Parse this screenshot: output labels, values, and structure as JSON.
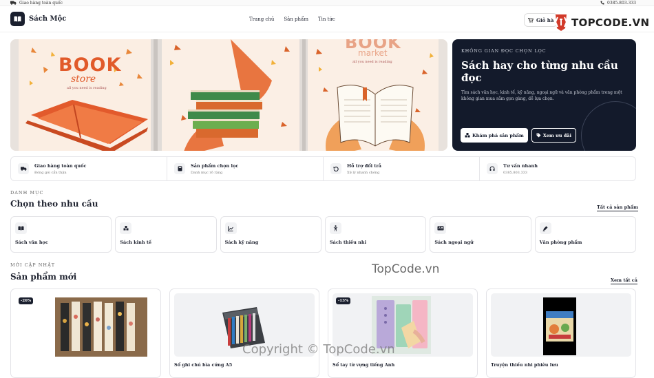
{
  "topbar": {
    "left": "Giao hàng toàn quốc",
    "right": "0385.803.333"
  },
  "nav": {
    "brand": "Sách Mộc",
    "items": [
      "Trang chủ",
      "Sản phẩm",
      "Tin tức"
    ],
    "cart_label": "Giỏ hà"
  },
  "watermark": {
    "brand": "TOPCODE.VN",
    "center": "TopCode.vn",
    "copyright": "Copyright © TopCode.vn"
  },
  "hero": {
    "panel1_line1": "BOOK",
    "panel1_line2": "store",
    "panel1_small": "all you need is reading",
    "panel3_line1": "BOOK",
    "panel3_line2": "market",
    "panel3_small": "all you need is reading"
  },
  "promo": {
    "eyebrow": "KHÔNG GIAN ĐỌC CHỌN LỌC",
    "title": "Sách hay cho từng nhu cầu đọc",
    "desc": "Tìm sách văn học, kinh tế, kỹ năng, ngoại ngữ và văn phòng phẩm trong một không gian mua sắm gọn gàng, dễ lựa chọn.",
    "btn_primary": "Khám phá sản phẩm",
    "btn_secondary": "Xem ưu đãi"
  },
  "features": [
    {
      "title": "Giao hàng toàn quốc",
      "sub": "Đóng gói cẩn thận",
      "icon": "truck-icon"
    },
    {
      "title": "Sản phẩm chọn lọc",
      "sub": "Danh mục rõ ràng",
      "icon": "book-icon"
    },
    {
      "title": "Hỗ trợ đổi trả",
      "sub": "Xử lý nhanh chóng",
      "icon": "undo-icon"
    },
    {
      "title": "Tư vấn nhanh",
      "sub": "0385.803.333",
      "icon": "headset-icon"
    }
  ],
  "categories": {
    "eyebrow": "DANH MỤC",
    "title": "Chọn theo nhu cầu",
    "see_all": "Tất cả sản phẩm",
    "items": [
      {
        "label": "Sách văn học",
        "icon": "open-book-icon"
      },
      {
        "label": "Sách kinh tế",
        "icon": "boxes-icon"
      },
      {
        "label": "Sách kỹ năng",
        "icon": "chart-icon"
      },
      {
        "label": "Sách thiếu nhi",
        "icon": "child-icon"
      },
      {
        "label": "Sách ngoại ngữ",
        "icon": "language-icon"
      },
      {
        "label": "Văn phòng phẩm",
        "icon": "pen-icon"
      }
    ]
  },
  "products": {
    "eyebrow": "MỚI CẬP NHẬT",
    "title": "Sản phẩm mới",
    "see_all": "Xem tất cả",
    "items": [
      {
        "name": "",
        "badge": "-26%"
      },
      {
        "name": "Sổ ghi chú bìa cứng A5",
        "badge": ""
      },
      {
        "name": "Sổ tay từ vựng tiếng Anh",
        "badge": "-13%"
      },
      {
        "name": "Truyện thiếu nhi phiêu lưu",
        "badge": ""
      }
    ]
  }
}
